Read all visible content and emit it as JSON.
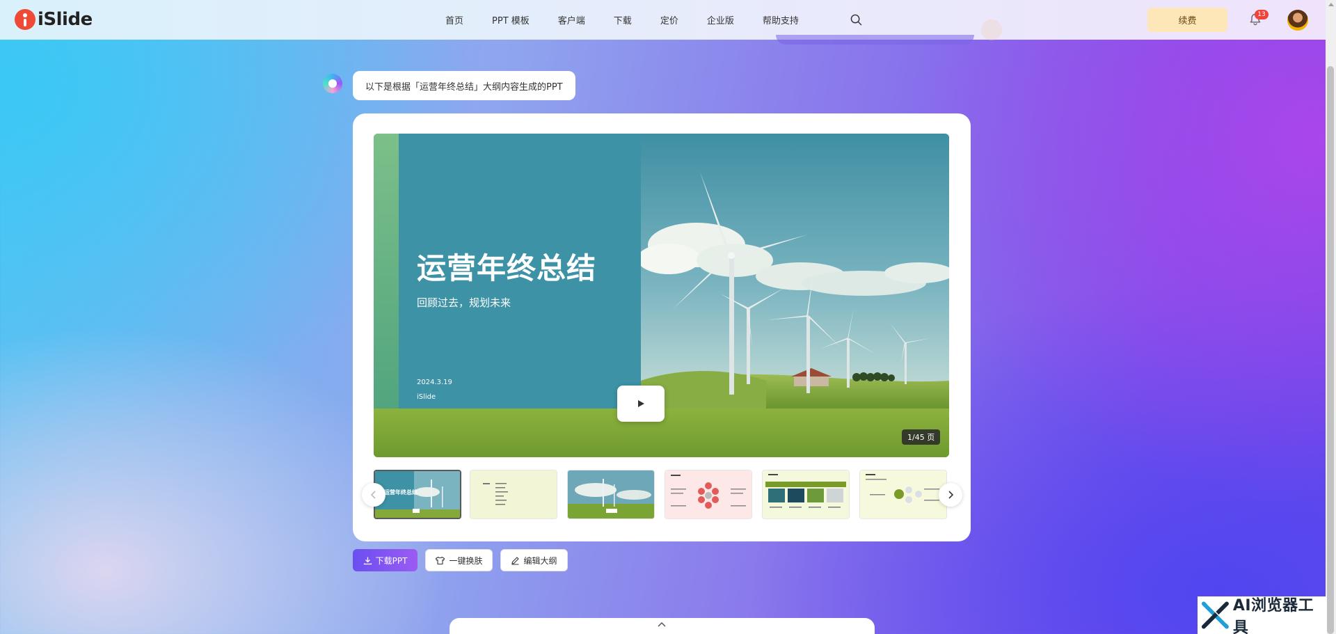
{
  "header": {
    "logo_text": "iSlide",
    "nav": [
      {
        "label": "首页"
      },
      {
        "label": "PPT 模板"
      },
      {
        "label": "客户端"
      },
      {
        "label": "下载"
      },
      {
        "label": "定价"
      },
      {
        "label": "企业版"
      },
      {
        "label": "帮助支持"
      }
    ],
    "renew_label": "续费",
    "notification_count": "13",
    "icons": [
      "search-icon",
      "bell-icon",
      "user-avatar"
    ]
  },
  "assistant": {
    "message": "以下是根据「运营年终总结」大纲内容生成的PPT"
  },
  "slide": {
    "title": "运营年终总结",
    "subtitle": "回顾过去，规划未来",
    "date": "2024.3.19",
    "author": "iSlide",
    "page_indicator": "1/45 页",
    "colors": {
      "panel": "#3d92a6",
      "grass": "#7aa534",
      "sky": "#5fa3b5"
    }
  },
  "thumbnails": {
    "count_visible": 6,
    "active_index": 0,
    "items": [
      {
        "kind": "cover",
        "title": "运营年终总结"
      },
      {
        "kind": "text-list"
      },
      {
        "kind": "photo"
      },
      {
        "kind": "diagram-circle"
      },
      {
        "kind": "image-grid"
      },
      {
        "kind": "diagram-icons"
      }
    ]
  },
  "actions": {
    "download_label": "下载PPT",
    "reskin_label": "一键换肤",
    "edit_outline_label": "编辑大纲"
  },
  "watermark": {
    "text": "AI浏览器工具"
  },
  "theme": {
    "accent": "#7b55f2",
    "renew_bg": "#fde6b8",
    "badge_red": "#f0433a"
  }
}
